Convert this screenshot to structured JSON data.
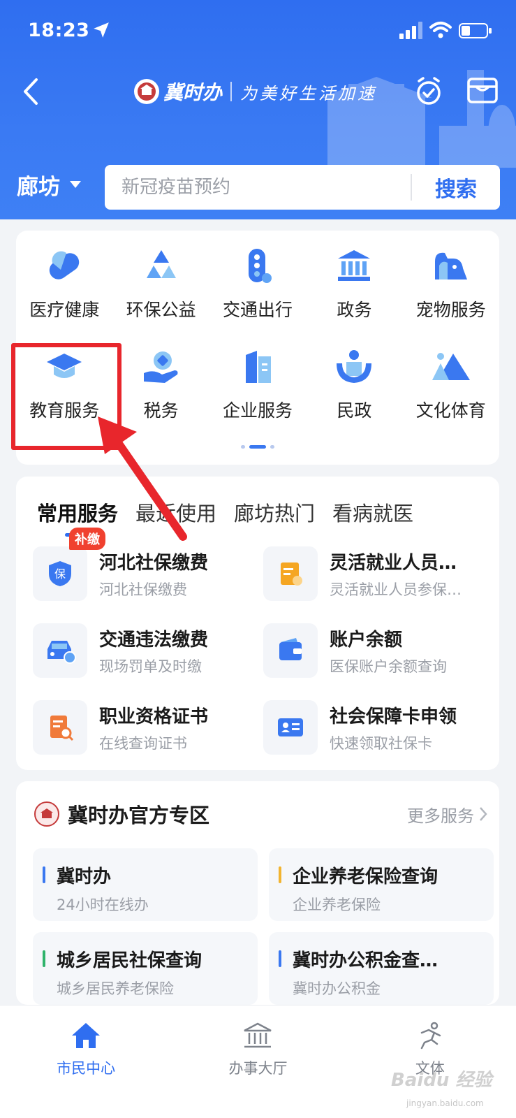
{
  "status_bar": {
    "time": "18:23"
  },
  "header": {
    "brand_name": "冀时办",
    "slogan": "为美好生活加速",
    "city": "廊坊",
    "search": {
      "placeholder": "新冠疫苗预约",
      "button_label": "搜索"
    }
  },
  "services": [
    {
      "label": "医疗健康",
      "icon": "medical-icon"
    },
    {
      "label": "环保公益",
      "icon": "recycle-icon"
    },
    {
      "label": "交通出行",
      "icon": "traffic-light-icon"
    },
    {
      "label": "政务",
      "icon": "government-building-icon"
    },
    {
      "label": "宠物服务",
      "icon": "pet-icon"
    },
    {
      "label": "教育服务",
      "icon": "graduation-cap-icon"
    },
    {
      "label": "税务",
      "icon": "tax-hand-icon"
    },
    {
      "label": "企业服务",
      "icon": "enterprise-building-icon"
    },
    {
      "label": "民政",
      "icon": "civil-affairs-icon"
    },
    {
      "label": "文化体育",
      "icon": "mountain-icon"
    }
  ],
  "common": {
    "tabs": [
      "常用服务",
      "最近使用",
      "廊坊热门",
      "看病就医"
    ],
    "active_tab": "常用服务",
    "items": [
      {
        "title": "河北社保缴费",
        "subtitle": "河北社保缴费",
        "icon": "social-insurance-icon",
        "badge": "补缴"
      },
      {
        "title": "灵活就业人员…",
        "subtitle": "灵活就业人员参保…",
        "icon": "document-edit-icon"
      },
      {
        "title": "交通违法缴费",
        "subtitle": "现场罚单及时缴",
        "icon": "car-fine-icon"
      },
      {
        "title": "账户余额",
        "subtitle": "医保账户余额查询",
        "icon": "wallet-icon"
      },
      {
        "title": "职业资格证书",
        "subtitle": "在线查询证书",
        "icon": "certificate-search-icon"
      },
      {
        "title": "社会保障卡申领",
        "subtitle": "快速领取社保卡",
        "icon": "id-card-icon"
      }
    ]
  },
  "official": {
    "title": "冀时办官方专区",
    "more_label": "更多服务",
    "items": [
      {
        "title": "冀时办",
        "subtitle": "24小时在线办",
        "bar_color": "#3a78f0"
      },
      {
        "title": "企业养老保险查询",
        "subtitle": "企业养老保险",
        "bar_color": "#f2b430"
      },
      {
        "title": "城乡居民社保查询",
        "subtitle": "城乡居民养老保险",
        "bar_color": "#2fb36b"
      },
      {
        "title": "冀时办公积金查…",
        "subtitle": "冀时办公积金",
        "bar_color": "#3a78f0"
      }
    ]
  },
  "bottom_nav": [
    {
      "label": "市民中心",
      "icon": "home-icon",
      "active": true
    },
    {
      "label": "办事大厅",
      "icon": "hall-icon",
      "active": false
    },
    {
      "label": "文体",
      "icon": "running-icon",
      "active": false
    }
  ],
  "watermark": {
    "text": "Baidu 经验",
    "sub": "jingyan.baidu.com"
  },
  "colors": {
    "primary": "#2f6ef0",
    "highlight": "#e8262c",
    "badge": "#f0412f"
  }
}
